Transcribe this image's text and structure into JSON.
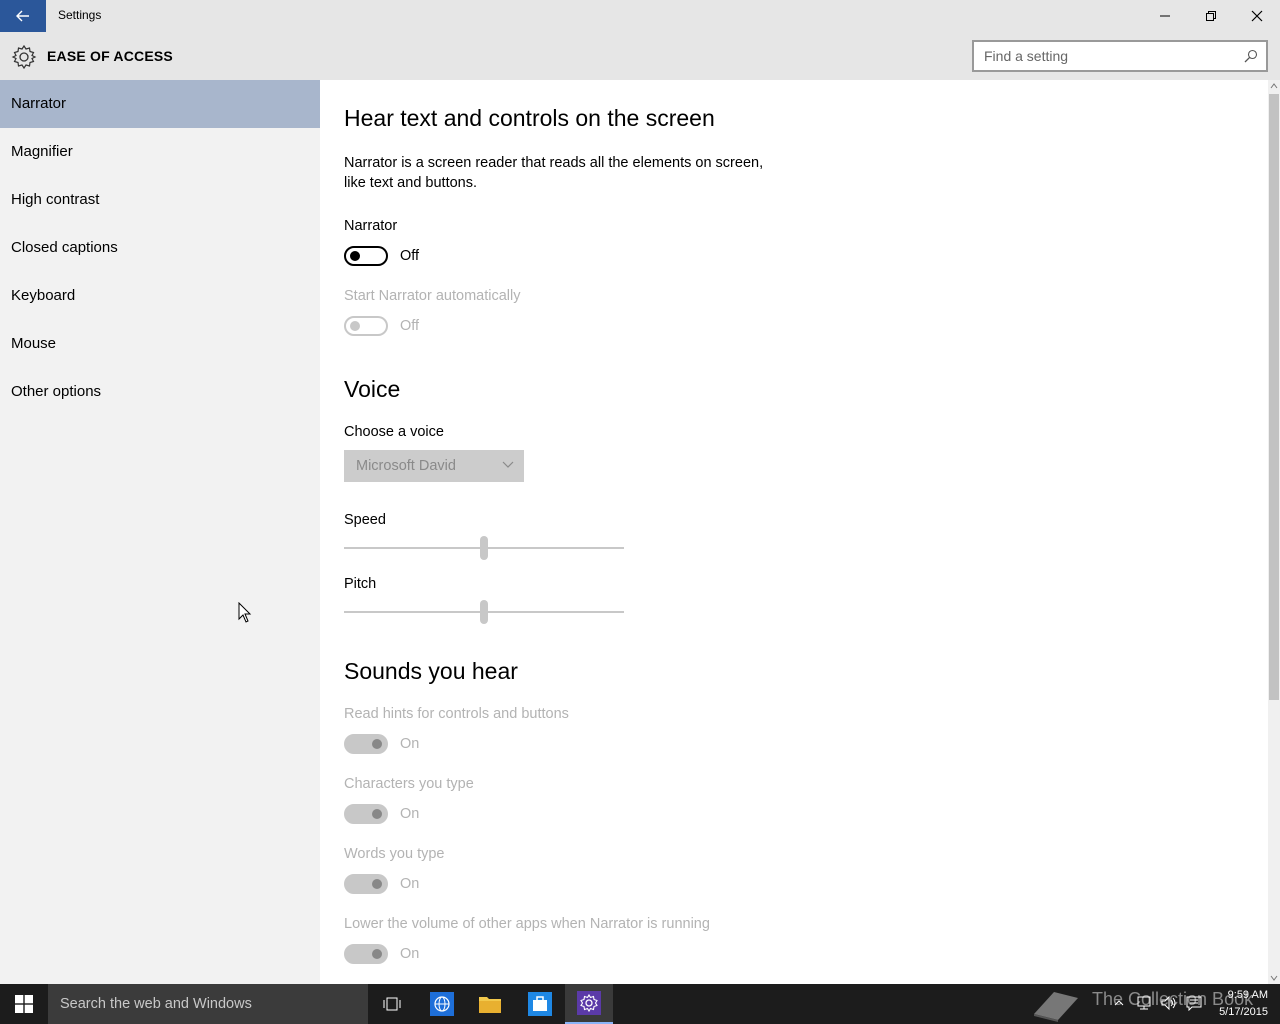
{
  "window": {
    "title": "Settings"
  },
  "header": {
    "title": "EASE OF ACCESS",
    "search_placeholder": "Find a setting"
  },
  "sidebar": {
    "items": [
      {
        "label": "Narrator",
        "selected": true
      },
      {
        "label": "Magnifier"
      },
      {
        "label": "High contrast"
      },
      {
        "label": "Closed captions"
      },
      {
        "label": "Keyboard"
      },
      {
        "label": "Mouse"
      },
      {
        "label": "Other options"
      }
    ]
  },
  "main": {
    "section1": {
      "title": "Hear text and controls on the screen",
      "desc_line1": "Narrator is a screen reader that reads all the elements on screen,",
      "desc_line2": "like text and buttons.",
      "narrator_label": "Narrator",
      "narrator_state": "Off",
      "auto_label": "Start Narrator automatically",
      "auto_state": "Off"
    },
    "voice": {
      "title": "Voice",
      "choose_label": "Choose a voice",
      "selected_voice": "Microsoft David",
      "speed_label": "Speed",
      "speed_level": 0.5,
      "pitch_label": "Pitch",
      "pitch_level": 0.5
    },
    "sounds": {
      "title": "Sounds you hear",
      "hints_label": "Read hints for controls and buttons",
      "hints_state": "On",
      "chars_label": "Characters you type",
      "chars_state": "On",
      "words_label": "Words you type",
      "words_state": "On",
      "lower_label": "Lower the volume of other apps when Narrator is running",
      "lower_state": "On"
    }
  },
  "taskbar": {
    "search_text": "Search the web and Windows",
    "time": "9:59 AM",
    "date": "5/17/2015",
    "watermark": "The Collection Book"
  },
  "colors": {
    "accent": "#2b579a",
    "selected_nav": "#a8b6cc",
    "taskbar": "#1c1c1c"
  }
}
